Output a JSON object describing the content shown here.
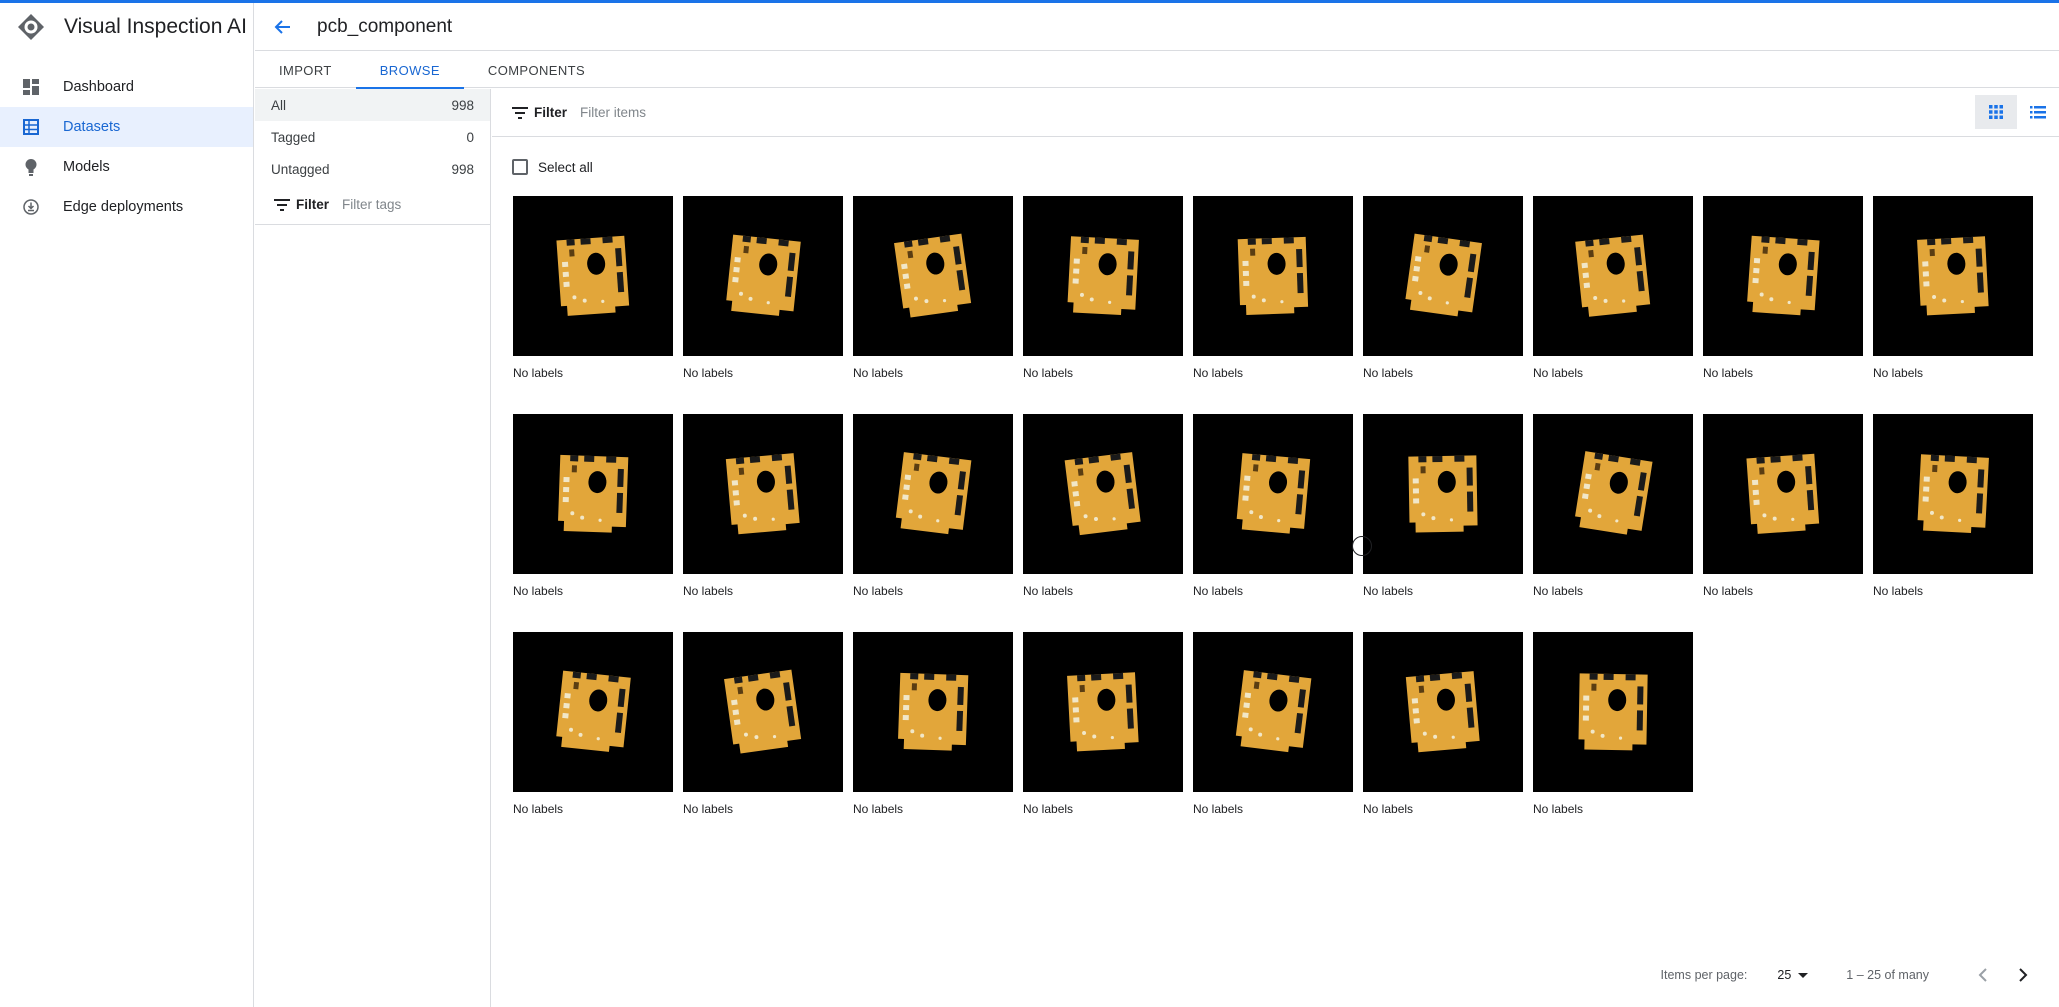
{
  "app": {
    "title": "Visual Inspection AI"
  },
  "nav": {
    "items": [
      {
        "label": "Dashboard",
        "icon": "dashboard-icon",
        "active": false
      },
      {
        "label": "Datasets",
        "icon": "datasets-icon",
        "active": true
      },
      {
        "label": "Models",
        "icon": "lightbulb-icon",
        "active": false
      },
      {
        "label": "Edge deployments",
        "icon": "edge-deploy-icon",
        "active": false
      }
    ]
  },
  "header": {
    "title": "pcb_component"
  },
  "tabs": [
    {
      "label": "IMPORT",
      "active": false
    },
    {
      "label": "BROWSE",
      "active": true
    },
    {
      "label": "COMPONENTS",
      "active": false
    }
  ],
  "tag_panel": {
    "rows": [
      {
        "label": "All",
        "count": "998"
      },
      {
        "label": "Tagged",
        "count": "0"
      },
      {
        "label": "Untagged",
        "count": "998"
      }
    ],
    "filter_label": "Filter",
    "filter_placeholder": "Filter tags"
  },
  "content": {
    "filter_label": "Filter",
    "filter_placeholder": "Filter items",
    "select_all_label": "Select all",
    "item_label": "No labels",
    "item_count": 25
  },
  "paginator": {
    "items_per_page_label": "Items per page:",
    "page_size": "25",
    "range": "1 – 25 of many"
  },
  "colors": {
    "accent": "#1a73e8",
    "active_nav_bg": "#e8f0fe",
    "pcb_board": "#e2a63a",
    "thumb_bg": "#000000"
  }
}
